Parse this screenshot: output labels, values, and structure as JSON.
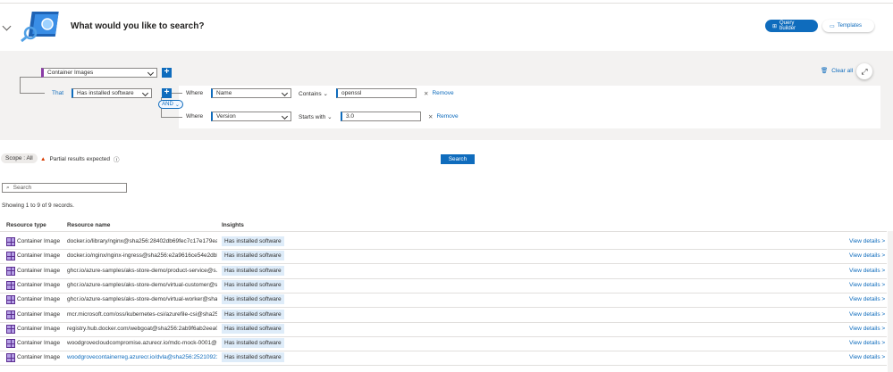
{
  "header": {
    "title": "What would you like to search?",
    "query_builder_label": "Query builder",
    "templates_label": "Templates"
  },
  "builder": {
    "root_type": "Container Images",
    "that_label": "That",
    "relation": "Has installed software",
    "conditions": [
      {
        "where_label": "Where",
        "field": "Name",
        "operator": "Contains",
        "value": "openssl",
        "remove_label": "Remove"
      },
      {
        "where_label": "Where",
        "field": "Version",
        "operator": "Starts with",
        "value": "3.0",
        "remove_label": "Remove"
      }
    ],
    "and_label": "AND",
    "clear_all_label": "Clear all"
  },
  "scope_label": "Scope : All",
  "partial_label": "Partial results expected",
  "search_button_label": "Search",
  "search_placeholder": "Search",
  "showing_text": "Showing 1 to 9 of 9 records.",
  "table": {
    "columns": [
      "Resource type",
      "Resource name",
      "Insights"
    ],
    "rows": [
      {
        "type": "Container Image",
        "name": "docker.io/library/nginx@sha256:28402db69fec7c17e179ea...",
        "insight": "Has installed software",
        "action": "View details >"
      },
      {
        "type": "Container Image",
        "name": "docker.io/nginx/nginx-ingress@sha256:e2a9616ce54e2dbb...",
        "insight": "Has installed software",
        "action": "View details >"
      },
      {
        "type": "Container Image",
        "name": "ghcr.io/azure-samples/aks-store-demo/product-service@s...",
        "insight": "Has installed software",
        "action": "View details >"
      },
      {
        "type": "Container Image",
        "name": "ghcr.io/azure-samples/aks-store-demo/virtual-customer@s...",
        "insight": "Has installed software",
        "action": "View details >"
      },
      {
        "type": "Container Image",
        "name": "ghcr.io/azure-samples/aks-store-demo/virtual-worker@sha...",
        "insight": "Has installed software",
        "action": "View details >"
      },
      {
        "type": "Container Image",
        "name": "mcr.microsoft.com/oss/kubernetes-csi/azurefile-csi@sha25...",
        "insight": "Has installed software",
        "action": "View details >"
      },
      {
        "type": "Container Image",
        "name": "registry.hub.docker.com/webgoat@sha256:2ab9f6ab2eea0...",
        "insight": "Has installed software",
        "action": "View details >"
      },
      {
        "type": "Container Image",
        "name": "woodgrovecloudcompromise.azurecr.io/mdc-mock-0001@...",
        "insight": "Has installed software",
        "action": "View details >"
      },
      {
        "type": "Container Image",
        "name": "woodgrovecontainerreg.azurecr.io/dvla@sha256:25210921...",
        "insight": "Has installed software",
        "action": "View details >",
        "link": true
      }
    ]
  }
}
